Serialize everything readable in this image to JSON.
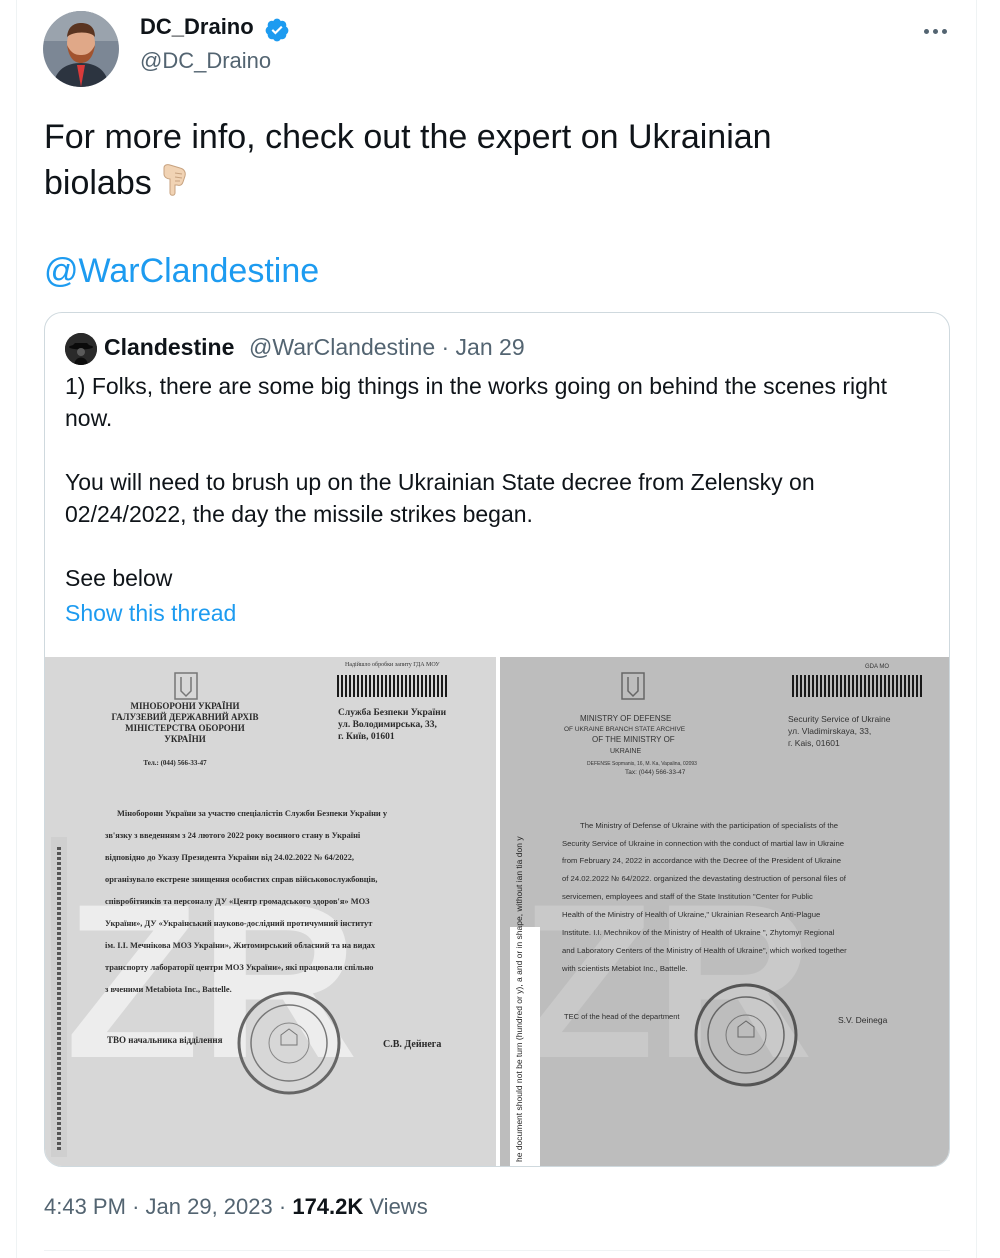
{
  "tweet": {
    "author_name": "DC_Draino",
    "author_handle": "@DC_Draino",
    "text_line1": "For more info, check out the expert on Ukrainian",
    "text_line2": "biolabs",
    "mention": "@WarClandestine",
    "time": "4:43 PM",
    "separator": "·",
    "date": "Jan 29, 2023",
    "views_count": "174.2K",
    "views_label": "Views",
    "icons": {
      "verified": "verified-badge-icon",
      "more": "more-options-icon",
      "emoji": "backhand-index-pointing-down-icon"
    },
    "colors": {
      "accent": "#1d9bf0",
      "text": "#0f1419",
      "secondary": "#536471",
      "border": "#cfd9de"
    }
  },
  "quote": {
    "author_name": "Clandestine",
    "meta": "@WarClandestine · Jan 29",
    "paragraph1": "1) Folks, there are  some big things in the works going on behind the scenes right now.",
    "paragraph2": "You will need to brush up on the Ukrainian State decree from Zelensky on 02/24/2022, the day the missile strikes began.",
    "paragraph3": "See below",
    "show_thread": "Show this thread"
  },
  "doc_left": {
    "stamp_text": "Надійшло обробки запиту ГДА МОУ",
    "header_left": [
      "МІНОБОРОНИ УКРАЇНИ",
      "ГАЛУЗЕВИЙ ДЕРЖАВНИЙ АРХІВ",
      "МІНІСТЕРСТВА ОБОРОНИ",
      "УКРАЇНИ",
      "Тел.: (044) 566-33-47"
    ],
    "header_right": [
      "Служба Безпеки України",
      "ул. Володимирська, 33,",
      "г. Київ, 01601"
    ],
    "body": [
      "Міноборони України за участю спеціалістів Служби Безпеки України у",
      "зв'язку з введенням з 24 лютого 2022 року воєнного стану в Україні",
      "відповідно до Указу Президента України від 24.02.2022 № 64/2022,",
      "організувало екстрене знищення особистих справ військовослужбовців,",
      "співробітників та персоналу ДУ «Центр громадського здоров'я» МОЗ",
      "України», ДУ «Український науково-дослідний протичумний інститут",
      "ім. І.І. Мечнікова МОЗ України», Житомирський обласний та на видах",
      "транспорту лабораторії центри МОЗ України», які працювали спільно",
      "з вченими Metabiota Inc., Battelle."
    ],
    "signature_left": "ТВО начальника відділення",
    "signature_right": "С.В. Дейнега"
  },
  "doc_right": {
    "stamp_text": "GDA MO",
    "header_left": [
      "MINISTRY OF DEFENSE",
      "OF UKRAINE BRANCH STATE ARCHIVE",
      "OF THE MINISTRY OF",
      "UKRAINE",
      "DEFENSE Sopmanis, 16, M. Ka, Vapalina, 02093",
      "Tax: (044) 566-33-47"
    ],
    "header_right": [
      "Security Service of Ukraine",
      "ул. Vladimirskaya, 33,",
      "г. Kais, 01601"
    ],
    "body": [
      "The Ministry of Defense of Ukraine with the participation of specialists of the",
      "Security Service of Ukraine in connection with the conduct of martial law in Ukraine",
      "from February 24, 2022 in accordance with the Decree of the President of Ukraine",
      "of 24.02.2022 № 64/2022. organized the devastating destruction of personal files of",
      "servicemen, employees and staff of the State Institution \"Center for Public",
      "Health of the Ministry of Health of Ukraine,\" Ukrainian Research Anti-Plague",
      "Institute. I.I. Mechnikov of the Ministry of Health of Ukraine \", Zhytomyr Regional",
      "and Laboratory Centers of the Ministry of Health of Ukraine\", which worked together",
      "with scientists Metabiot Inc., Battelle."
    ],
    "signature_left": "TEC of the head of the department",
    "signature_right": "S.V. Deinega",
    "side_note": "he document should not be turn (hundred or y), a and or in shape, without ian tia don y"
  }
}
